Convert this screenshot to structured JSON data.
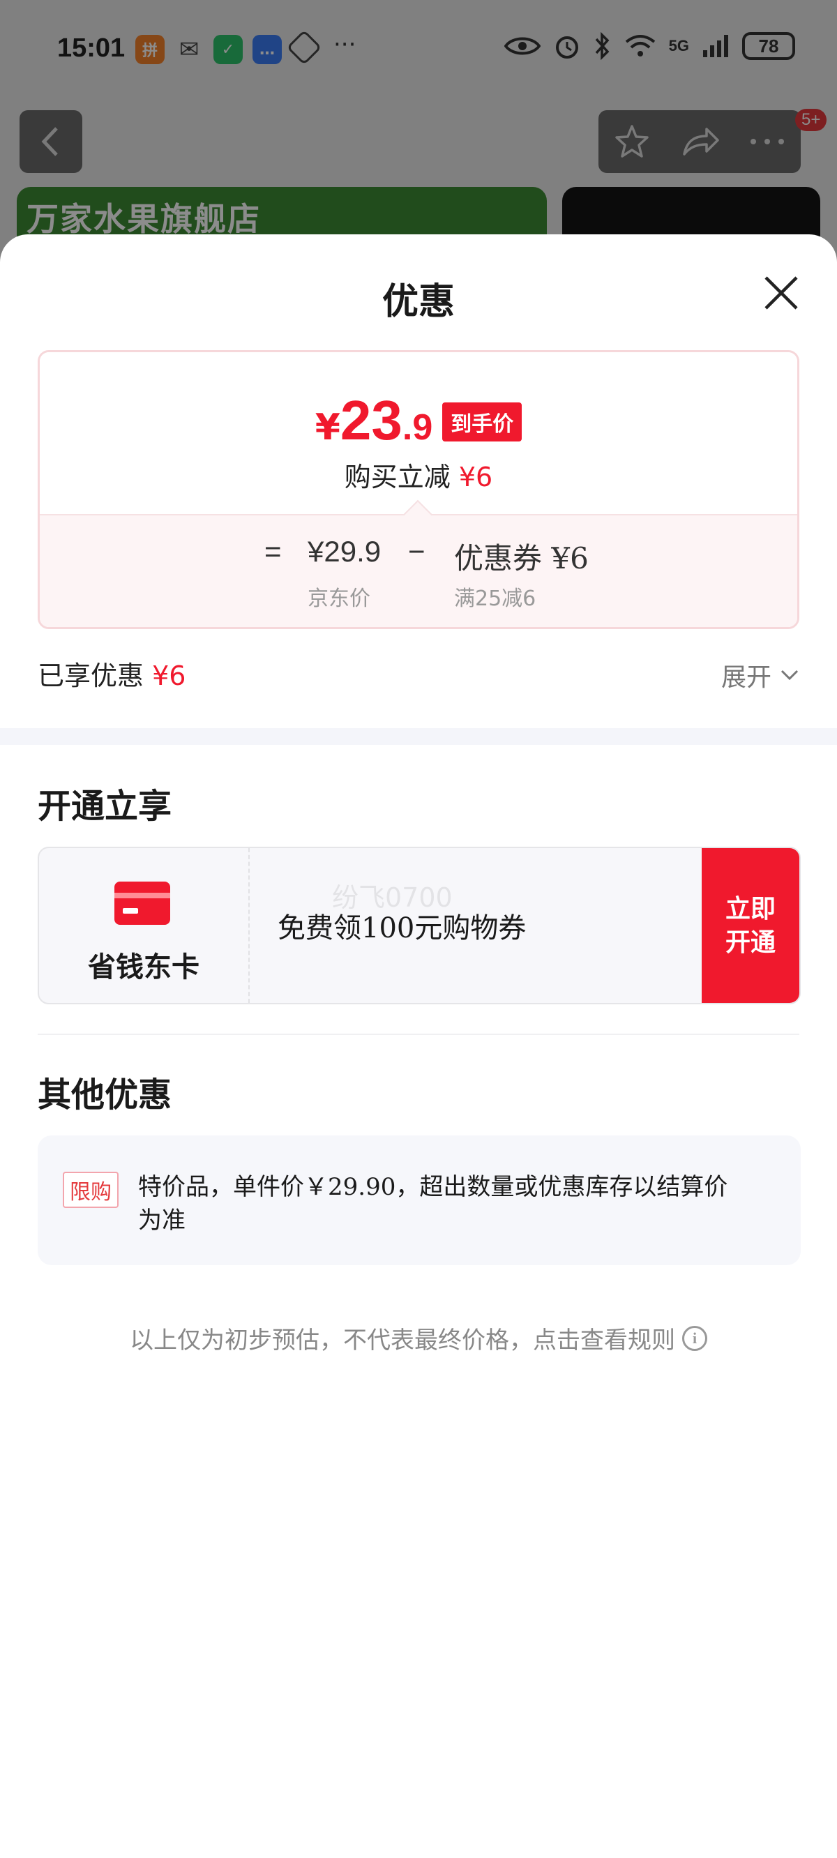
{
  "status_bar": {
    "time": "15:01",
    "network": "5G",
    "battery": "78"
  },
  "background_page": {
    "store_name": "万家水果旗舰店",
    "notification_badge": "5+"
  },
  "sheet": {
    "title": "优惠",
    "price_card": {
      "currency": "¥",
      "price_int": "23",
      "price_dec": ".9",
      "final_tag": "到手价",
      "reduce_label": "购买立减",
      "reduce_amount": "¥6",
      "equals": "=",
      "minus": "−",
      "jd_price": "¥29.9",
      "jd_price_label": "京东价",
      "coupon": "优惠券 ¥6",
      "coupon_condition": "满25减6"
    },
    "enjoyed": {
      "label": "已享优惠",
      "amount": "¥6",
      "expand_label": "展开"
    },
    "membership_section": {
      "title": "开通立享",
      "card_name": "省钱东卡",
      "watermark": "纷飞0700",
      "description": "免费领100元购物券",
      "button_label": "立即开通"
    },
    "other_section": {
      "title": "其他优惠",
      "tag": "限购",
      "text": "特价品，单件价￥29.90，超出数量或优惠库存以结算价为准"
    },
    "disclaimer": "以上仅为初步预估，不代表最终价格，点击查看规则"
  },
  "colors": {
    "accent_red": "#f0192d",
    "banner_green": "#3d8a34"
  }
}
